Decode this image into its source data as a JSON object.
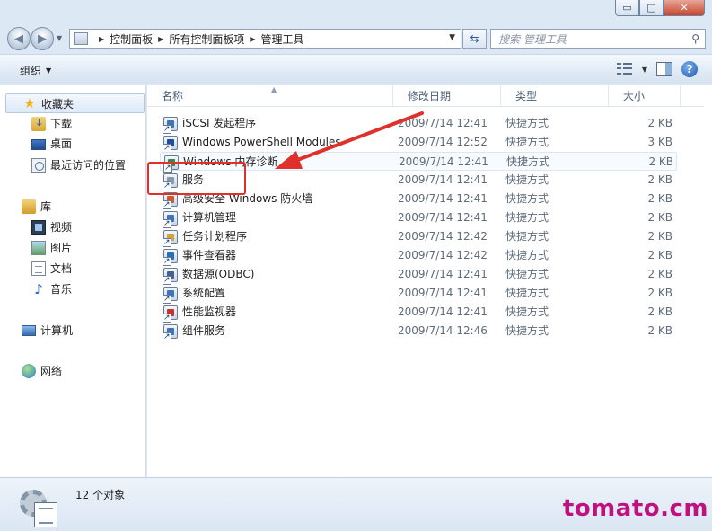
{
  "window": {
    "caption": {
      "minimize": "▭",
      "maximize": "□",
      "close": "✕"
    }
  },
  "address": {
    "back_icon": "◀",
    "forward_icon": "▶",
    "breadcrumbs": [
      "控制面板",
      "所有控制面板项",
      "管理工具"
    ],
    "search_placeholder": "搜索 管理工具"
  },
  "toolbar": {
    "organize_label": "组织",
    "help_label": "?"
  },
  "navpane": {
    "favorites": {
      "label": "收藏夹",
      "items": [
        "下载",
        "桌面",
        "最近访问的位置"
      ]
    },
    "libraries": {
      "label": "库",
      "items": [
        "视频",
        "图片",
        "文档",
        "音乐"
      ]
    },
    "computer": "计算机",
    "network": "网络"
  },
  "columns": [
    "名称",
    "修改日期",
    "类型",
    "大小"
  ],
  "files": [
    {
      "name": "iSCSI 发起程序",
      "date": "2009/7/14 12:41",
      "type": "快捷方式",
      "size": "2 KB",
      "color": "#3c74be"
    },
    {
      "name": "Windows PowerShell Modules",
      "date": "2009/7/14 12:52",
      "type": "快捷方式",
      "size": "3 KB",
      "color": "#1c4f9c"
    },
    {
      "name": "Windows 内存诊断",
      "date": "2009/7/14 12:41",
      "type": "快捷方式",
      "size": "2 KB",
      "color": "#2f8f4a"
    },
    {
      "name": "服务",
      "date": "2009/7/14 12:41",
      "type": "快捷方式",
      "size": "2 KB",
      "color": "#8a98aa"
    },
    {
      "name": "高级安全 Windows 防火墙",
      "date": "2009/7/14 12:41",
      "type": "快捷方式",
      "size": "2 KB",
      "color": "#cc5a2a"
    },
    {
      "name": "计算机管理",
      "date": "2009/7/14 12:41",
      "type": "快捷方式",
      "size": "2 KB",
      "color": "#3c74be"
    },
    {
      "name": "任务计划程序",
      "date": "2009/7/14 12:42",
      "type": "快捷方式",
      "size": "2 KB",
      "color": "#d1a33a"
    },
    {
      "name": "事件查看器",
      "date": "2009/7/14 12:42",
      "type": "快捷方式",
      "size": "2 KB",
      "color": "#2a6fb8"
    },
    {
      "name": "数据源(ODBC)",
      "date": "2009/7/14 12:41",
      "type": "快捷方式",
      "size": "2 KB",
      "color": "#46628c"
    },
    {
      "name": "系统配置",
      "date": "2009/7/14 12:41",
      "type": "快捷方式",
      "size": "2 KB",
      "color": "#3c74be"
    },
    {
      "name": "性能监视器",
      "date": "2009/7/14 12:41",
      "type": "快捷方式",
      "size": "2 KB",
      "color": "#c2352e"
    },
    {
      "name": "组件服务",
      "date": "2009/7/14 12:46",
      "type": "快捷方式",
      "size": "2 KB",
      "color": "#3c74be"
    }
  ],
  "status": {
    "count_text": "12 个对象"
  },
  "watermark": "tomato.cm",
  "colors": {
    "annotation_red": "#e0302b",
    "watermark": "#c0127e"
  }
}
